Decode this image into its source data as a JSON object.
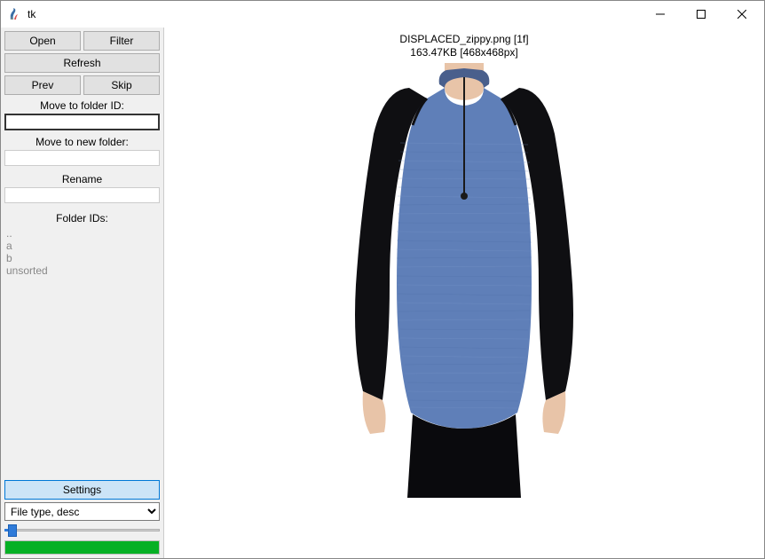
{
  "window": {
    "title": "tk"
  },
  "sidebar": {
    "open_label": "Open",
    "filter_label": "Filter",
    "refresh_label": "Refresh",
    "prev_label": "Prev",
    "skip_label": "Skip",
    "move_id_label": "Move to folder ID:",
    "move_id_value": "",
    "move_new_label": "Move to new folder:",
    "move_new_value": "",
    "rename_label": "Rename",
    "folder_ids_label": "Folder IDs:",
    "folders": [
      "..",
      "a",
      "b",
      "unsorted"
    ],
    "settings_label": "Settings",
    "sort_value": "File type, desc",
    "slider_value": 0,
    "progress_value": 100
  },
  "image": {
    "info_line1": "DISPLACED_zippy.png [1f]",
    "info_line2": "163.47KB [468x468px]"
  }
}
